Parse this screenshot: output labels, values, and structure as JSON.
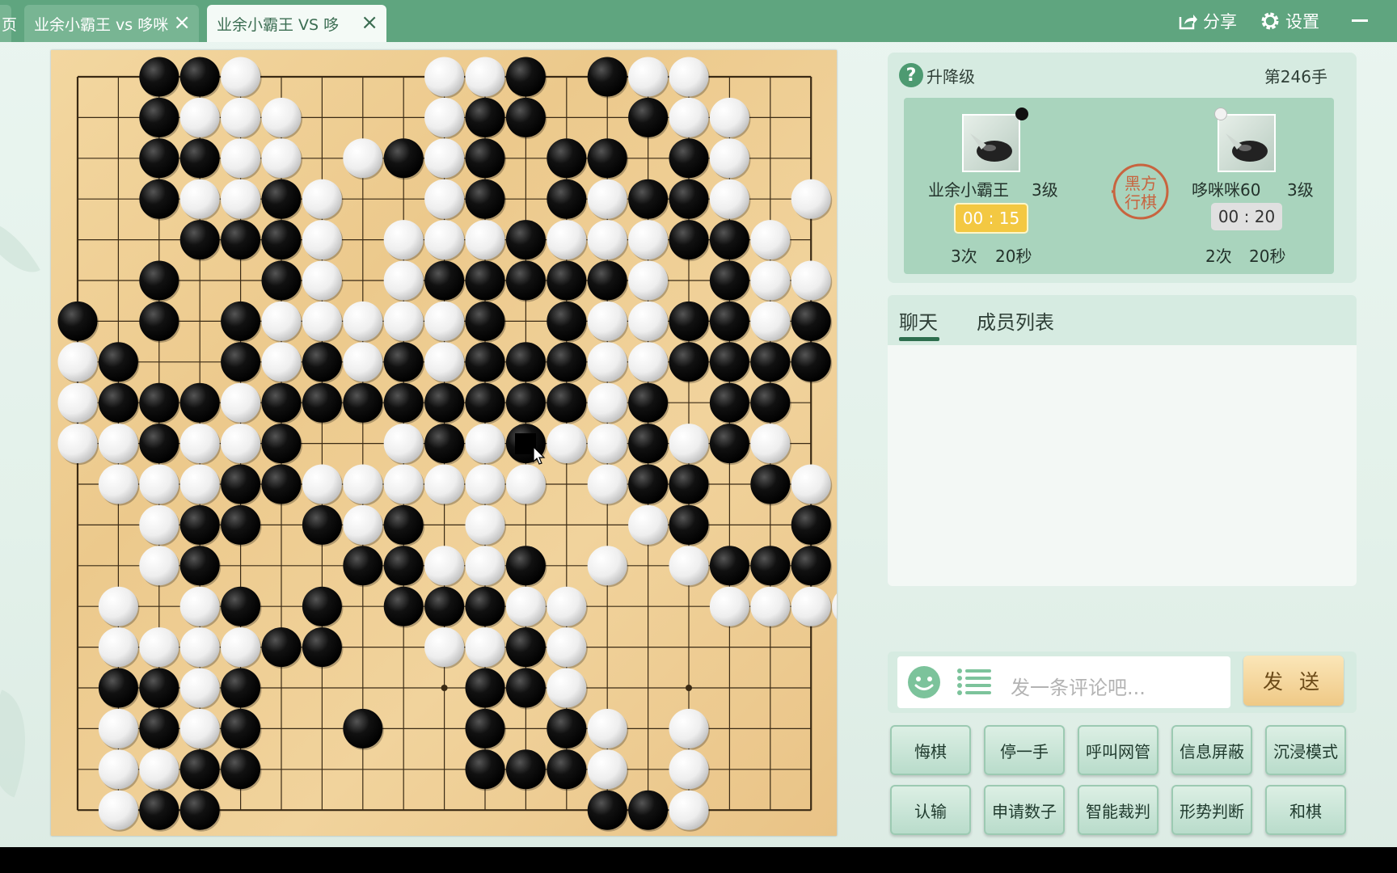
{
  "tabs": [
    {
      "label": "页"
    },
    {
      "label": "业余小霸王 vs 哆咪"
    },
    {
      "label": "业余小霸王 VS 哆"
    }
  ],
  "toolbar": {
    "share_label": "分享",
    "settings_label": "设置"
  },
  "game": {
    "mode_label": "升降级",
    "move_count": "第246手",
    "turn_indicator": "黑方行棋",
    "black_player": {
      "name": "业余小霸王",
      "level": "3级",
      "timer": "00 : 15",
      "byoyomi_count": "3次",
      "byoyomi_time": "20秒"
    },
    "white_player": {
      "name": "哆咪咪60",
      "level": "3级",
      "timer": "00 : 20",
      "byoyomi_count": "2次",
      "byoyomi_time": "20秒"
    }
  },
  "chat": {
    "tabs": [
      "聊天",
      "成员列表"
    ],
    "input_placeholder": "发一条评论吧...",
    "send_label": "发 送"
  },
  "actions": {
    "row1": [
      "悔棋",
      "停一手",
      "呼叫网管",
      "信息屏蔽",
      "沉浸模式"
    ],
    "row2": [
      "认输",
      "申请数子",
      "智能裁判",
      "形势判断",
      "和棋"
    ]
  },
  "colors": {
    "accent": "#5fa57f",
    "panel": "#d6ebe1",
    "timer_active": "#f3c842",
    "timer_idle": "#e0e0e0"
  },
  "board": {
    "size": 19,
    "last_move": [
      9,
      11
    ],
    "rows": [
      "..XXO....OOX.XOO...",
      "..XOOO...OXX..XOO..",
      "..XXOO.OXOX.XX.XO..",
      "..XOOXO..OX.XOXXO.O",
      "...XXXO.OOOXOOOXXO.",
      "..X..XO.OXXXXXO.XOO",
      "X.X.XOOOOOX.XOOXXOX",
      "OX..XOXOXOXXXOOXXXX",
      "OXXXOXXXXXXXXOX.XX.",
      "OOXOOX..OXOXOOXOXO.",
      ".OOOXXOOOOOO.OXX.XO",
      "..OXX.XOX.O...OX..X",
      "..OX...XXOOX.O.OXXX",
      ".O.OX.X.XXXOO...OOOO",
      ".OOOOXX..OOXO......",
      ".XXOX.....XXO......",
      ".OXOX..X..X.XO.O...",
      ".OOXX.....XXXO.O...",
      ".OXX.........XXO..."
    ]
  }
}
